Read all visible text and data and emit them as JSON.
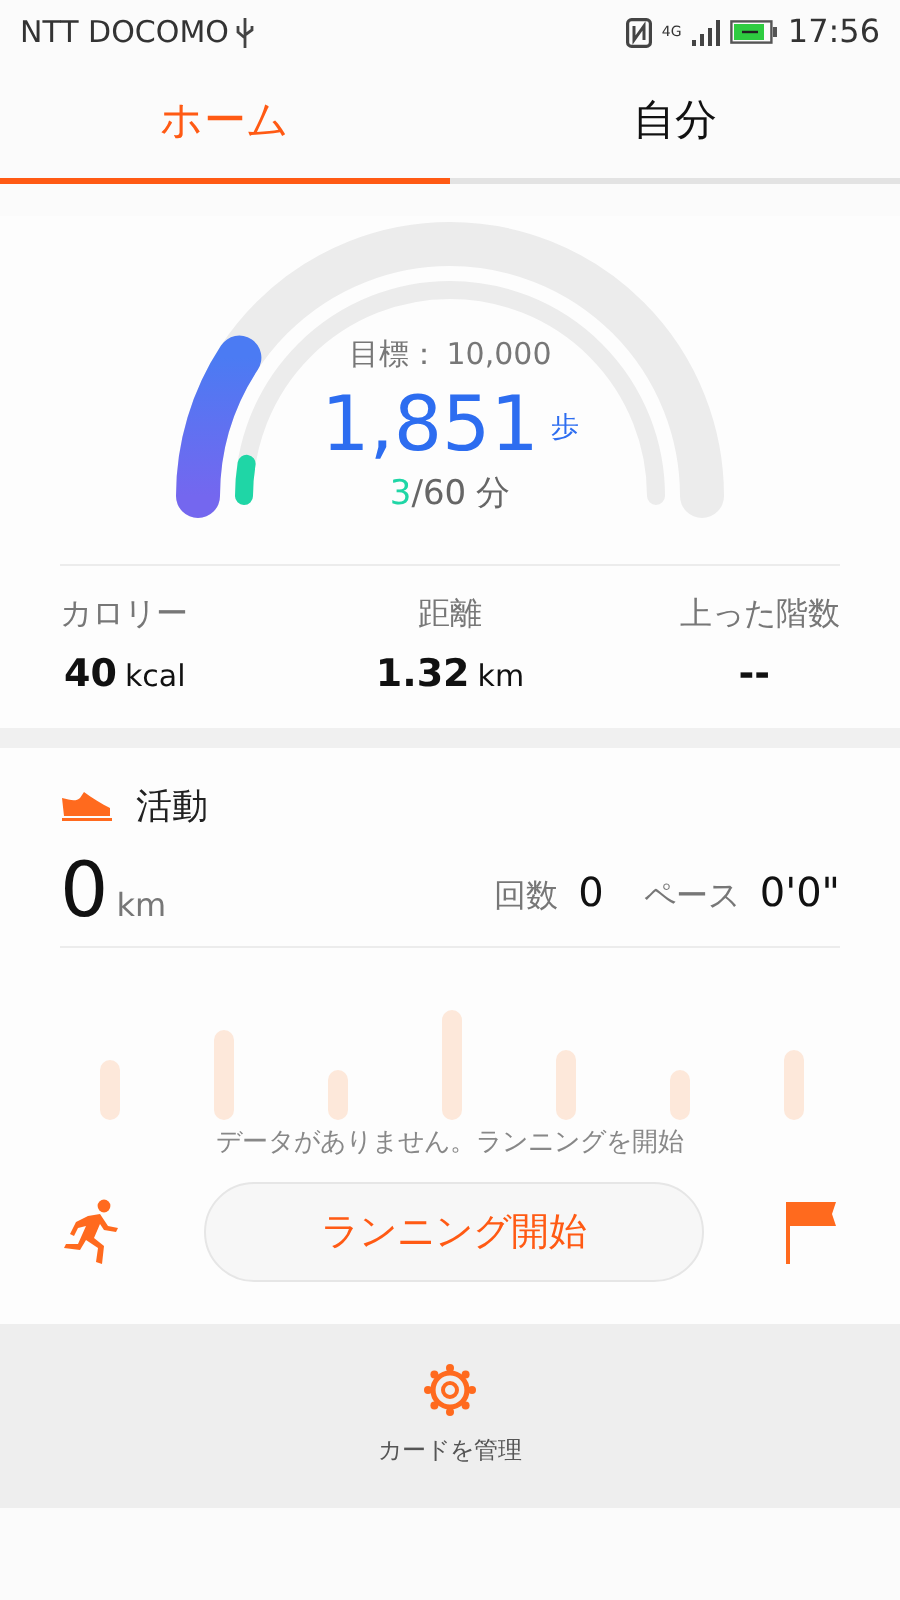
{
  "status_bar": {
    "carrier": "NTT DOCOMO",
    "network": "4G",
    "time": "17:56"
  },
  "tabs": [
    {
      "label": "ホーム",
      "selected": true
    },
    {
      "label": "自分",
      "selected": false
    }
  ],
  "steps": {
    "goal_label": "目標：",
    "goal": "10,000",
    "count": "1,851",
    "unit": "歩",
    "minutes": "3",
    "minutes_goal": "/60",
    "minutes_unit": "分"
  },
  "stats": [
    {
      "label": "カロリー",
      "value": "40",
      "unit": "kcal"
    },
    {
      "label": "距離",
      "value": "1.32",
      "unit": "km"
    },
    {
      "label": "上った階数",
      "value": "--"
    }
  ],
  "activity": {
    "title": "活動",
    "distance": "0",
    "distance_unit": "km",
    "count_label": "回数",
    "count": "0",
    "pace_label": "ペース",
    "pace": "0'0\"",
    "empty_message": "データがありません。ランニングを開始",
    "start_button": "ランニング開始"
  },
  "footer": {
    "manage_label": "カードを管理"
  }
}
